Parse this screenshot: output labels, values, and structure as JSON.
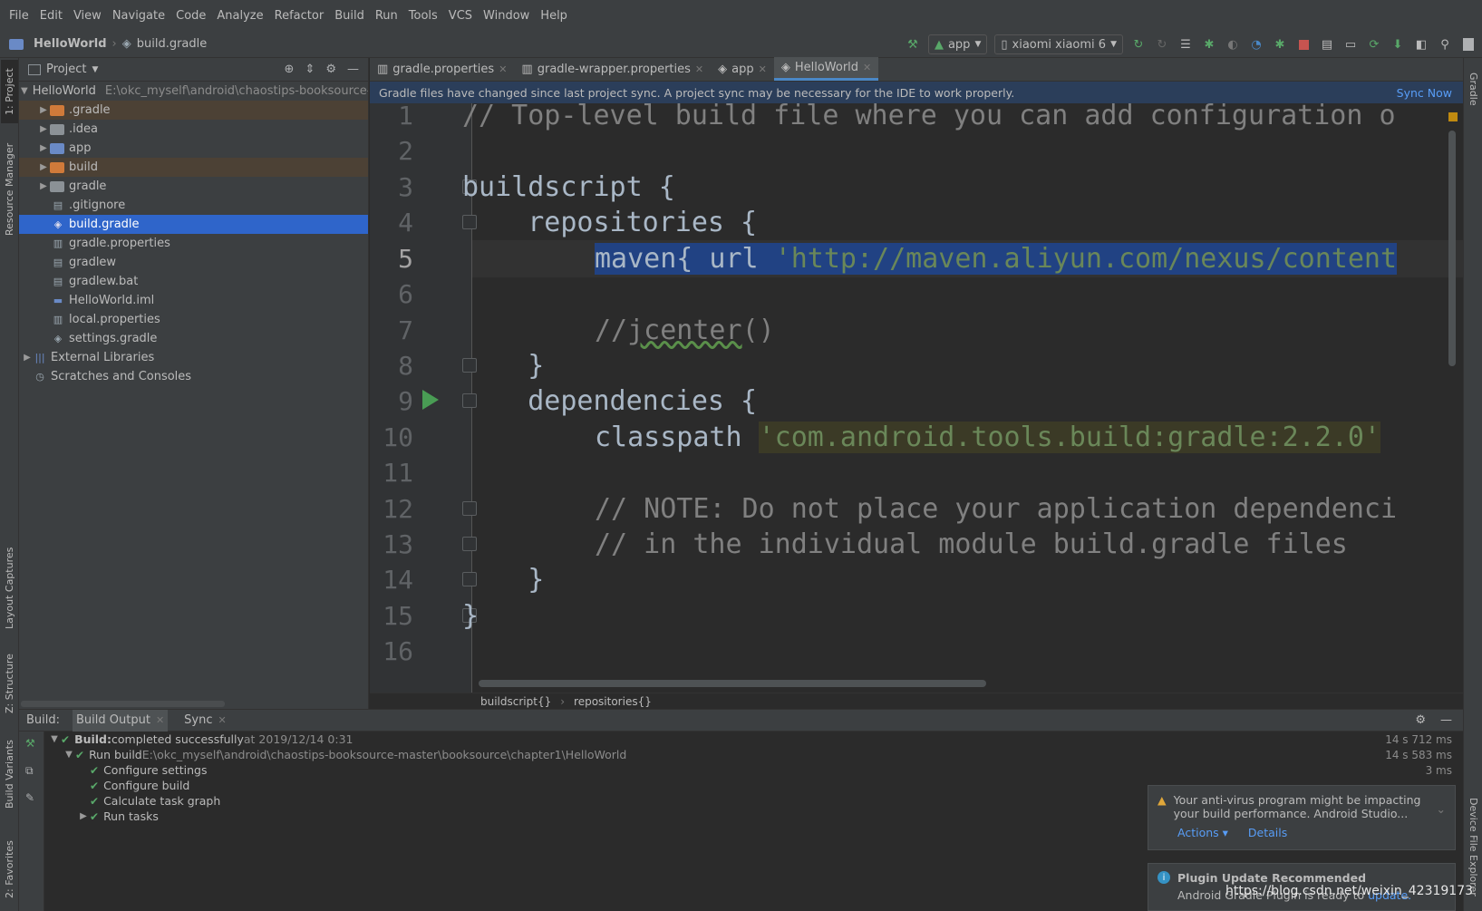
{
  "menu": [
    "File",
    "Edit",
    "View",
    "Navigate",
    "Code",
    "Analyze",
    "Refactor",
    "Build",
    "Run",
    "Tools",
    "VCS",
    "Window",
    "Help"
  ],
  "breadcrumb": {
    "project": "HelloWorld",
    "file": "build.gradle"
  },
  "toolbar": {
    "config": "app",
    "device": "xiaomi xiaomi 6"
  },
  "left_stripe": {
    "project": "1: Project",
    "resource_manager": "Resource Manager",
    "layout_captures": "Layout Captures",
    "structure": "Z: Structure",
    "build_variants": "Build Variants",
    "favorites": "2: Favorites"
  },
  "right_stripe": {
    "gradle": "Gradle",
    "device_explorer": "Device File Explorer"
  },
  "project_panel": {
    "title": "Project",
    "root": {
      "name": "HelloWorld",
      "path": "E:\\okc_myself\\android\\chaostips-booksource-"
    },
    "items": [
      {
        "name": ".gradle",
        "kind": "folder-orange"
      },
      {
        "name": ".idea",
        "kind": "folder-gray"
      },
      {
        "name": "app",
        "kind": "folder-blue"
      },
      {
        "name": "build",
        "kind": "folder-orange"
      },
      {
        "name": "gradle",
        "kind": "folder-gray"
      },
      {
        "name": ".gitignore",
        "kind": "file"
      },
      {
        "name": "build.gradle",
        "kind": "gradle"
      },
      {
        "name": "gradle.properties",
        "kind": "file"
      },
      {
        "name": "gradlew",
        "kind": "file"
      },
      {
        "name": "gradlew.bat",
        "kind": "file"
      },
      {
        "name": "HelloWorld.iml",
        "kind": "file"
      },
      {
        "name": "local.properties",
        "kind": "file"
      },
      {
        "name": "settings.gradle",
        "kind": "gradle"
      }
    ],
    "external": "External Libraries",
    "scratches": "Scratches and Consoles"
  },
  "tabs": [
    {
      "label": "gradle.properties"
    },
    {
      "label": "gradle-wrapper.properties"
    },
    {
      "label": "app"
    },
    {
      "label": "HelloWorld"
    }
  ],
  "banner": {
    "message": "Gradle files have changed since last project sync. A project sync may be necessary for the IDE to work properly.",
    "action": "Sync Now"
  },
  "code": {
    "line_numbers": [
      "1",
      "2",
      "3",
      "4",
      "5",
      "6",
      "7",
      "8",
      "9",
      "10",
      "11",
      "12",
      "13",
      "14",
      "15",
      "16"
    ],
    "l1": "// Top-level build file where you can add configuration o",
    "l3": "buildscript {",
    "l4": "    repositories {",
    "l5_kw": "maven{ url ",
    "l5_str": "'http://maven.aliyun.com/nexus/content",
    "l7_a": "//",
    "l7_b": "jcenter",
    "l7_c": "()",
    "l8": "    }",
    "l9": "    dependencies {",
    "l10_kw": "classpath ",
    "l10_str": "'com.android.tools.build:gradle:2.2.0'",
    "l12": "// NOTE: Do not place your application dependenci",
    "l13": "// in the individual module build.gradle files",
    "l14": "    }",
    "l15": "}"
  },
  "editor_breadcrumbs": [
    "buildscript{}",
    "repositories{}"
  ],
  "build_window": {
    "label": "Build:",
    "tabs": [
      "Build Output",
      "Sync"
    ],
    "rows": [
      {
        "bold": "Build:",
        "text": " completed successfully",
        "muted": " at 2019/12/14 0:31",
        "time": "14 s 712 ms"
      },
      {
        "bold": "",
        "text": "Run build ",
        "muted": "E:\\okc_myself\\android\\chaostips-booksource-master\\booksource\\chapter1\\HelloWorld",
        "time": "14 s 583 ms"
      },
      {
        "bold": "",
        "text": "Configure settings",
        "muted": "",
        "time": "3 ms"
      },
      {
        "bold": "",
        "text": "Configure build",
        "muted": "",
        "time": ""
      },
      {
        "bold": "",
        "text": "Calculate task graph",
        "muted": "",
        "time": ""
      },
      {
        "bold": "",
        "text": "Run tasks",
        "muted": "",
        "time": ""
      }
    ]
  },
  "notifications": {
    "antivirus": {
      "text1": "Your anti-virus program might be impacting",
      "text2": "your build performance. Android Studio...",
      "actions": "Actions ▾",
      "details": "Details"
    },
    "plugin": {
      "title": "Plugin Update Recommended",
      "text": "Android Gradle Plugin is ready to ",
      "link": "update."
    }
  },
  "watermark": "https://blog.csdn.net/weixin_42319173"
}
